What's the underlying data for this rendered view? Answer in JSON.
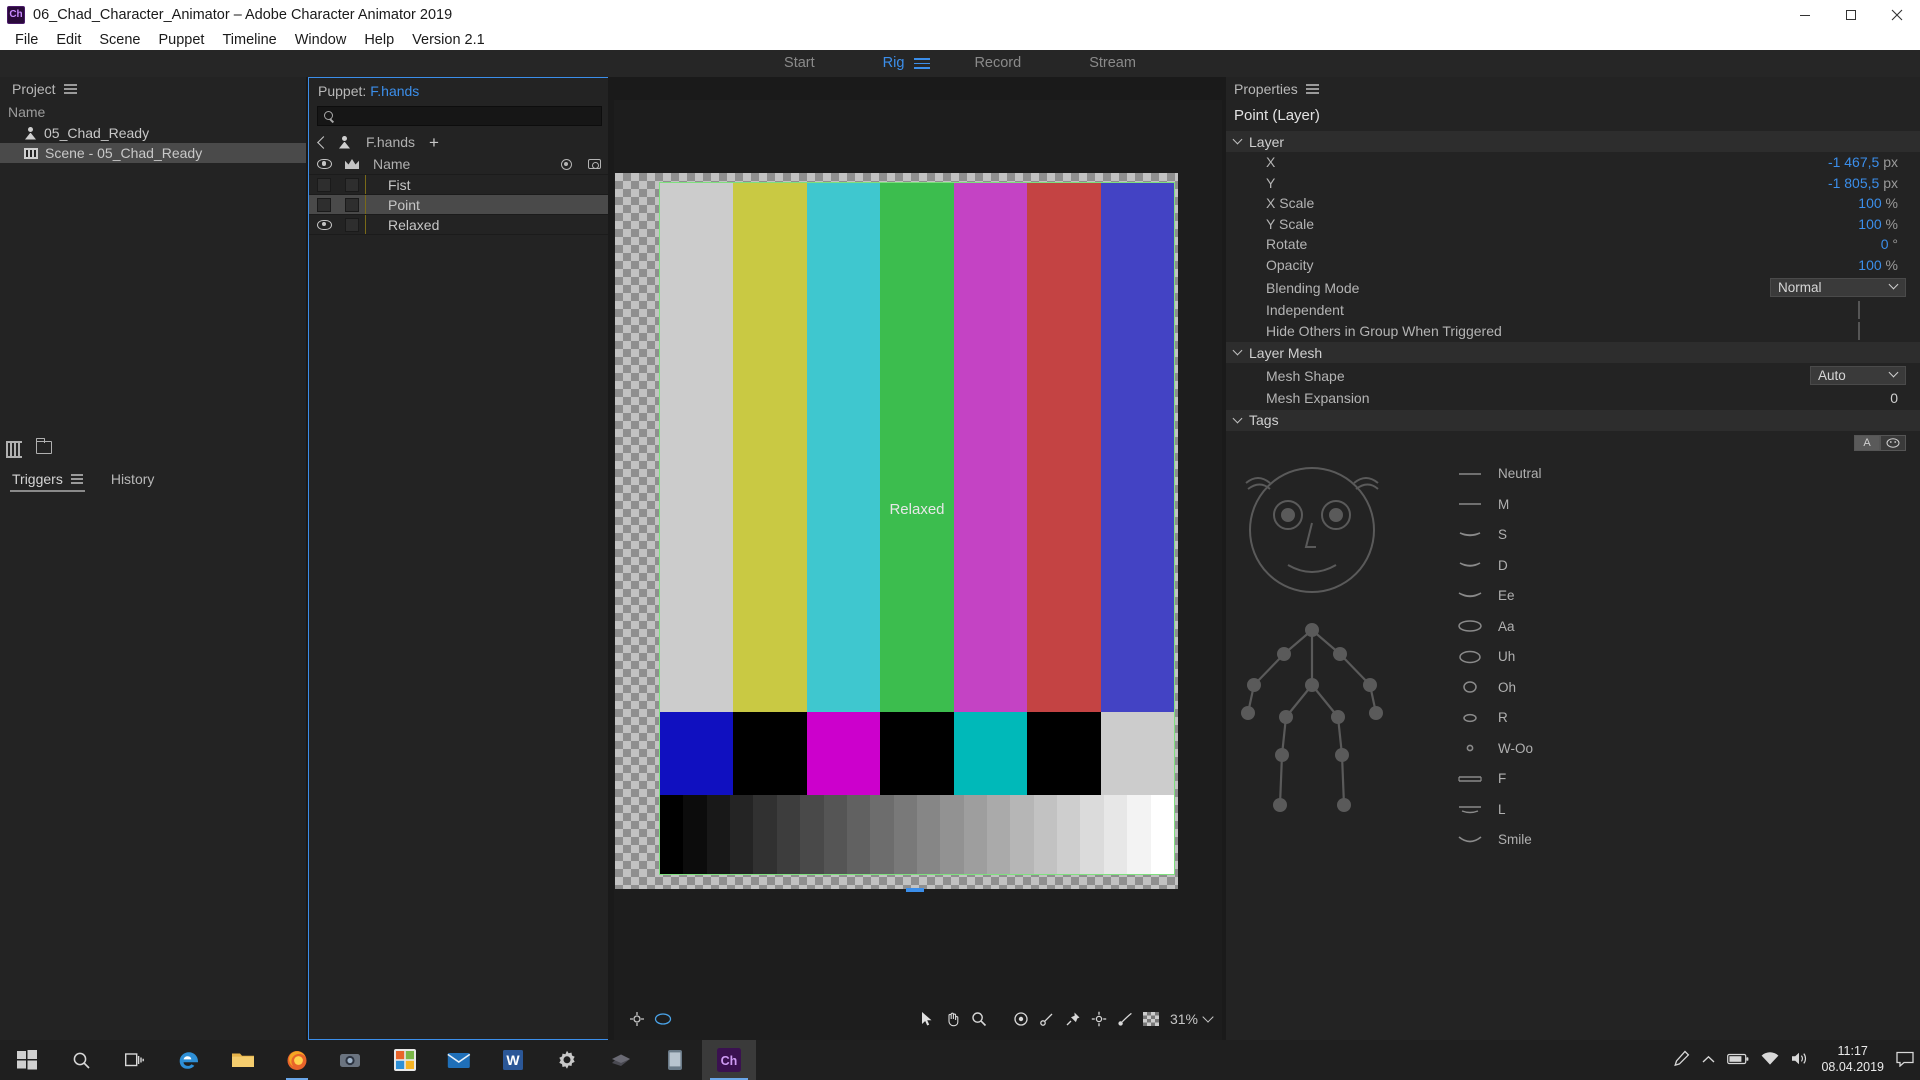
{
  "window": {
    "title": "06_Chad_Character_Animator – Adobe Character Animator 2019",
    "app_badge": "Ch",
    "minimize": "minimize-button",
    "maximize": "maximize-button",
    "close": "close-button"
  },
  "menu": {
    "items": [
      "File",
      "Edit",
      "Scene",
      "Puppet",
      "Timeline",
      "Window",
      "Help",
      "Version 2.1"
    ]
  },
  "workspace": {
    "tabs": [
      {
        "label": "Start",
        "active": false
      },
      {
        "label": "Rig",
        "active": true
      },
      {
        "label": "Record",
        "active": false
      },
      {
        "label": "Stream",
        "active": false
      }
    ]
  },
  "project": {
    "title": "Project",
    "column_header": "Name",
    "items": [
      {
        "label": "05_Chad_Ready",
        "icon": "puppet-icon",
        "selected": false
      },
      {
        "label": "Scene - 05_Chad_Ready",
        "icon": "scene-icon",
        "selected": true
      }
    ]
  },
  "triggers": {
    "tabs": [
      {
        "label": "Triggers",
        "active": true
      },
      {
        "label": "History",
        "active": false
      }
    ]
  },
  "puppet": {
    "title_prefix": "Puppet:",
    "title_name": "F.hands",
    "search_placeholder": "",
    "search_value": "",
    "breadcrumb": "F.hands",
    "add_label": "+",
    "columns": {
      "eye": "visibility",
      "crown": "favorite",
      "name": "Name",
      "record": "record",
      "camera": "camera"
    },
    "layers": [
      {
        "name": "Fist",
        "visible": false,
        "selected": false
      },
      {
        "name": "Point",
        "visible": false,
        "selected": true
      },
      {
        "name": "Relaxed",
        "visible": true,
        "selected": false
      }
    ]
  },
  "canvas": {
    "stage_label": "Relaxed",
    "zoom": "31%",
    "tools": [
      "origin-handle-tool",
      "mesh-tool",
      "select-tool",
      "hand-tool",
      "zoom-tool",
      "origin-tool",
      "dangle-tool",
      "stick-tool",
      "pin-tool",
      "handle-tool",
      "draggable-tool",
      "checker-toggle"
    ],
    "color_bars_top": [
      "#cccccc",
      "#c9c943",
      "#3fc7cf",
      "#3cbd4e",
      "#c443c4",
      "#c44343",
      "#4343c4"
    ],
    "color_bars_mid": [
      "#1010c0",
      "#000000",
      "#cc00cc",
      "#000000",
      "#00b9b9",
      "#000000",
      "#cccccc"
    ],
    "grayscale_steps": 22
  },
  "properties": {
    "title": "Properties",
    "subject": "Point (Layer)",
    "sections": [
      {
        "name": "Layer",
        "rows": [
          {
            "label": "X",
            "value": "-1 467,5",
            "unit": "px",
            "type": "value"
          },
          {
            "label": "Y",
            "value": "-1 805,5",
            "unit": "px",
            "type": "value"
          },
          {
            "label": "X Scale",
            "value": "100",
            "unit": "%",
            "type": "value"
          },
          {
            "label": "Y Scale",
            "value": "100",
            "unit": "%",
            "type": "value"
          },
          {
            "label": "Rotate",
            "value": "0",
            "unit": "°",
            "type": "value"
          },
          {
            "label": "Opacity",
            "value": "100",
            "unit": "%",
            "type": "value"
          },
          {
            "label": "Blending Mode",
            "value": "Normal",
            "type": "select"
          },
          {
            "label": "Independent",
            "value": false,
            "type": "checkbox"
          },
          {
            "label": "Hide Others in Group When Triggered",
            "value": false,
            "type": "checkbox"
          }
        ]
      },
      {
        "name": "Layer Mesh",
        "rows": [
          {
            "label": "Mesh Shape",
            "value": "Auto",
            "type": "select"
          },
          {
            "label": "Mesh Expansion",
            "value": "0",
            "type": "plain"
          }
        ]
      },
      {
        "name": "Tags",
        "rows": []
      }
    ],
    "tag_toggle": [
      {
        "label": "A",
        "selected": true
      },
      {
        "label": "face-icon",
        "selected": false
      }
    ],
    "tag_list": [
      {
        "label": "Neutral",
        "icon": "mouth-neutral"
      },
      {
        "label": "M",
        "icon": "mouth-m"
      },
      {
        "label": "S",
        "icon": "mouth-s"
      },
      {
        "label": "D",
        "icon": "mouth-d"
      },
      {
        "label": "Ee",
        "icon": "mouth-ee"
      },
      {
        "label": "Aa",
        "icon": "mouth-aa"
      },
      {
        "label": "Uh",
        "icon": "mouth-uh"
      },
      {
        "label": "Oh",
        "icon": "mouth-oh"
      },
      {
        "label": "R",
        "icon": "mouth-r"
      },
      {
        "label": "W-Oo",
        "icon": "mouth-woo"
      },
      {
        "label": "F",
        "icon": "mouth-f"
      },
      {
        "label": "L",
        "icon": "mouth-l"
      },
      {
        "label": "Smile",
        "icon": "mouth-smile"
      }
    ]
  },
  "taskbar": {
    "start": "start-button",
    "items": [
      "search-icon",
      "task-view-icon",
      "edge-icon",
      "file-explorer-icon",
      "firefox-icon",
      "camera-icon",
      "store-icon",
      "mail-icon",
      "word-icon",
      "settings-icon",
      "eraser-icon",
      "device-icon",
      "character-animator-icon"
    ],
    "active_item": "character-animator-icon",
    "tray": [
      "pen-icon",
      "chevron-up-icon",
      "battery-icon",
      "network-icon",
      "volume-icon"
    ],
    "time": "11:17",
    "date": "08.04.2019",
    "notifications": "notification-icon"
  },
  "colors": {
    "accent": "#3b8eea",
    "panel_bg": "#232323",
    "titlebar_bg": "#ffffff",
    "selection": "#4a4a4a"
  }
}
